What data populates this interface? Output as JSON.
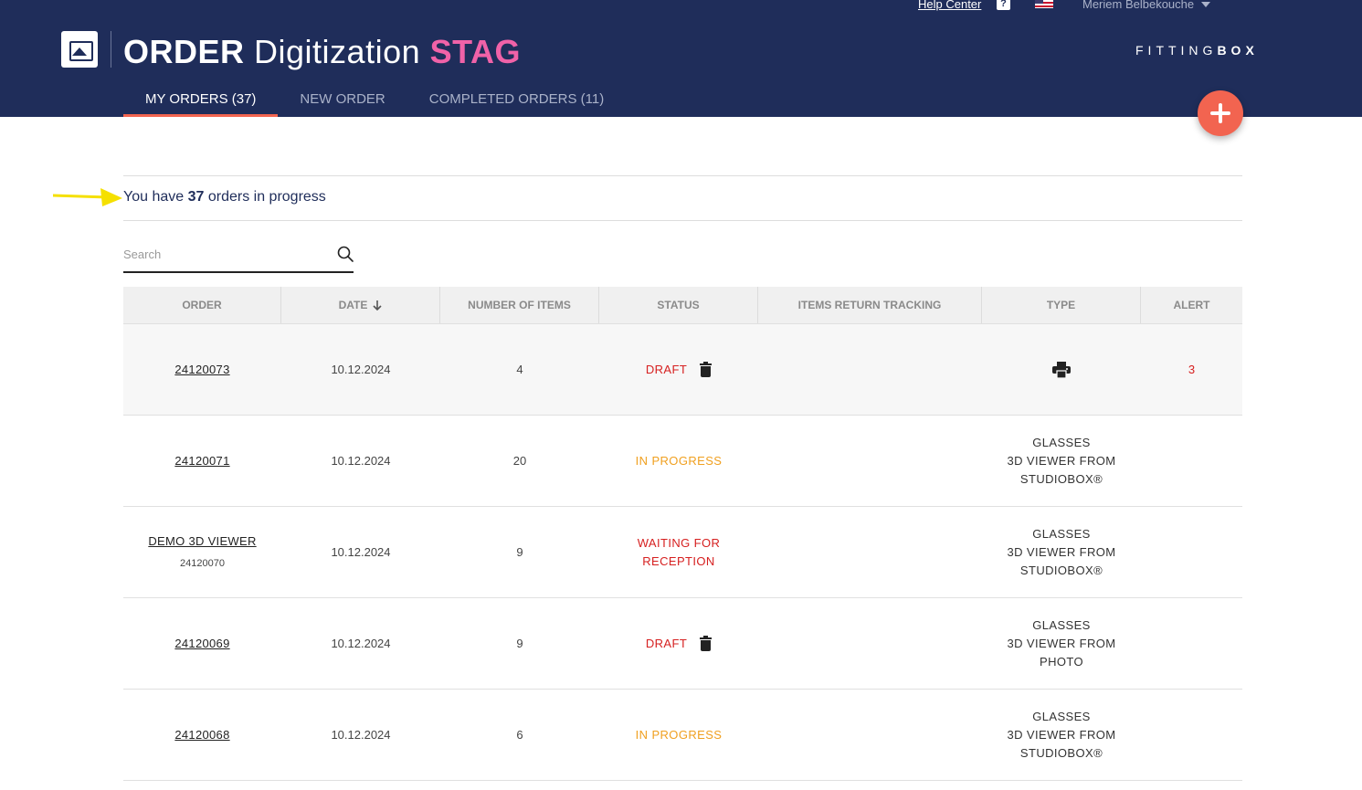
{
  "header": {
    "help_center": "Help Center",
    "help_icon": "?",
    "user_name": "Meriem Belbekouche",
    "title_part1": "ORDER",
    "title_part2": "Digitization",
    "title_part3": "STAG",
    "brand_left": "FITTING",
    "brand_right": "BOX",
    "tabs": [
      {
        "label": "MY ORDERS (37)",
        "active": true
      },
      {
        "label": "NEW ORDER",
        "active": false
      },
      {
        "label": "COMPLETED ORDERS (11)",
        "active": false
      }
    ]
  },
  "summary": {
    "prefix": "You have",
    "count": "37",
    "suffix": "orders in progress"
  },
  "search": {
    "placeholder": "Search"
  },
  "table": {
    "columns": [
      "ORDER",
      "DATE",
      "NUMBER OF ITEMS",
      "STATUS",
      "ITEMS RETURN TRACKING",
      "TYPE",
      "ALERT"
    ],
    "rows": [
      {
        "order": "24120073",
        "sub": "",
        "date": "10.12.2024",
        "items": "4",
        "status": "DRAFT",
        "status_color": "#d62020",
        "tracking": "",
        "type": [
          "",
          "",
          ""
        ],
        "alert": "3"
      },
      {
        "order": "24120071",
        "sub": "",
        "date": "10.12.2024",
        "items": "20",
        "status": "IN PROGRESS",
        "status_color": "#f0a020",
        "tracking": "",
        "type": [
          "GLASSES",
          "3D VIEWER FROM",
          "STUDIOBOX®"
        ],
        "alert": ""
      },
      {
        "order": "DEMO 3D VIEWER",
        "sub": "24120070",
        "date": "10.12.2024",
        "items": "9",
        "status": "WAITING FOR",
        "status2": "RECEPTION",
        "status_color": "#d62020",
        "tracking": "",
        "type": [
          "GLASSES",
          "3D VIEWER FROM",
          "STUDIOBOX®"
        ],
        "alert": ""
      },
      {
        "order": "24120069",
        "sub": "",
        "date": "10.12.2024",
        "items": "9",
        "status": "DRAFT",
        "status_color": "#d62020",
        "tracking": "",
        "type": [
          "GLASSES",
          "3D VIEWER FROM",
          "PHOTO"
        ],
        "alert": ""
      },
      {
        "order": "24120068",
        "sub": "",
        "date": "10.12.2024",
        "items": "6",
        "status": "IN PROGRESS",
        "status_color": "#f0a020",
        "tracking": "",
        "type": [
          "GLASSES",
          "3D VIEWER FROM",
          "STUDIOBOX®"
        ],
        "alert": ""
      }
    ]
  },
  "icons": {
    "app_logo": "image-icon",
    "fab": "plus-icon",
    "sort": "arrow-down-icon",
    "search": "search-icon",
    "trash": "trash-icon",
    "printer": "printer-icon",
    "annotation": "arrow-right-icon"
  },
  "colors": {
    "header_bg": "#1f2d5a",
    "accent": "#f26450",
    "stag_pink": "#f062a8",
    "status_red": "#d62020",
    "status_orange": "#f0a020",
    "annotation_yellow": "#f5e000"
  }
}
